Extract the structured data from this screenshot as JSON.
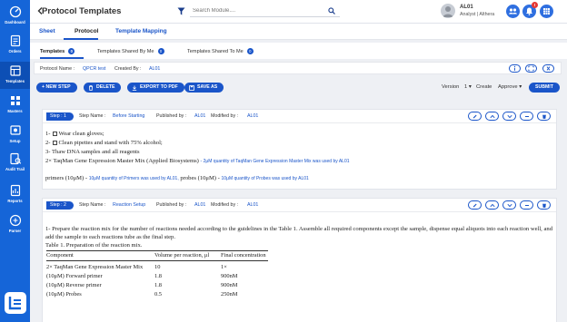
{
  "sidebar": {
    "items": [
      {
        "label": "Dashboard",
        "icon": "dashboard-icon"
      },
      {
        "label": "Orders",
        "icon": "orders-icon"
      },
      {
        "label": "Templates",
        "icon": "templates-icon"
      },
      {
        "label": "Masters",
        "icon": "masters-icon"
      },
      {
        "label": "Setup",
        "icon": "setup-icon"
      },
      {
        "label": "Audit Trail",
        "icon": "audit-icon"
      },
      {
        "label": "Reports",
        "icon": "reports-icon"
      },
      {
        "label": "Parser",
        "icon": "parser-icon"
      }
    ]
  },
  "header": {
    "title": "Protocol Templates",
    "search_placeholder": "Search Module....",
    "user_name": "AL01",
    "user_role": "Analyst | Althera",
    "notification_count": "!"
  },
  "tabs": [
    {
      "label": "Sheet"
    },
    {
      "label": "Protocol"
    },
    {
      "label": "Template Mapping"
    }
  ],
  "subtabs": [
    {
      "label": "Templates",
      "count": "0"
    },
    {
      "label": "Templates Shared By Me",
      "count": "0"
    },
    {
      "label": "Templates Shared To Me",
      "count": "0"
    }
  ],
  "info": {
    "protocol_label": "Protocol Name :",
    "protocol_value": "QPCR test",
    "created_label": "Created By :",
    "created_value": "AL01"
  },
  "toolbar": {
    "new_step": "+ NEW STEP",
    "delete": "DELETE",
    "export": "EXPORT TO PDF",
    "save_as": "SAVE AS",
    "version_label": "Version",
    "version_value": "1",
    "create_label": "Create",
    "create_value": "Approve",
    "submit": "SUBMIT"
  },
  "steps": [
    {
      "pill": "Step : 1",
      "name_label": "Step Name :",
      "name_value": "Before Starting",
      "published_label": "Published by :",
      "published_value": "AL01",
      "modified_label": "Modified by :",
      "modified_value": "AL01",
      "lines": {
        "l1_prefix": "1-",
        "l1_text": "Wear clean gloves;",
        "l2_prefix": "2-",
        "l2_text": "Clean pipettes and stand with 75% alcohol;",
        "l3": "3- Thaw DNA samples and all reagents",
        "l4": "2× TaqMan Gene Expression Master Mix (Applied Biosystems)",
        "l4_note": "- 2μM quantity of TaqMan Gene Expression Master Mix was used by AL01",
        "l5a": "primers (10μM) -",
        "l5a_note": "10μM quantity of Primers was used by AL01,",
        "l5b": "probes (10μM) -",
        "l5b_note": "10μM quantity of Probes was used by AL01"
      }
    },
    {
      "pill": "Step : 2",
      "name_label": "Step Name :",
      "name_value": "Reaction Setup",
      "published_label": "Published by :",
      "published_value": "AL01",
      "modified_label": "Modified by :",
      "modified_value": "AL01",
      "paragraph": "1- Prepare the reaction mix for the number of reactions needed according to the guidelines in the Table 1. Assemble all required components except the sample, dispense equal aliquots into each reaction well, and add the sample to each reactions tube as the final step.",
      "table_caption": "Table 1. Preparation of the reaction mix.",
      "table_headers": [
        "Component",
        "Volume per reaction, μl",
        "Final concentration"
      ],
      "table_rows": [
        [
          "2× TaqMan Gene Expression Master Mix",
          "10",
          "1×"
        ],
        [
          "(10μM) Forward primer",
          "1.8",
          "900nM"
        ],
        [
          "(10μM) Reverse primer",
          "1.8",
          "900nM"
        ],
        [
          "(10μM) Probes",
          "0.5",
          "250nM"
        ]
      ]
    }
  ],
  "colors": {
    "primary": "#1a55c9",
    "sidebar": "#1565d8",
    "alert": "#e53935"
  }
}
